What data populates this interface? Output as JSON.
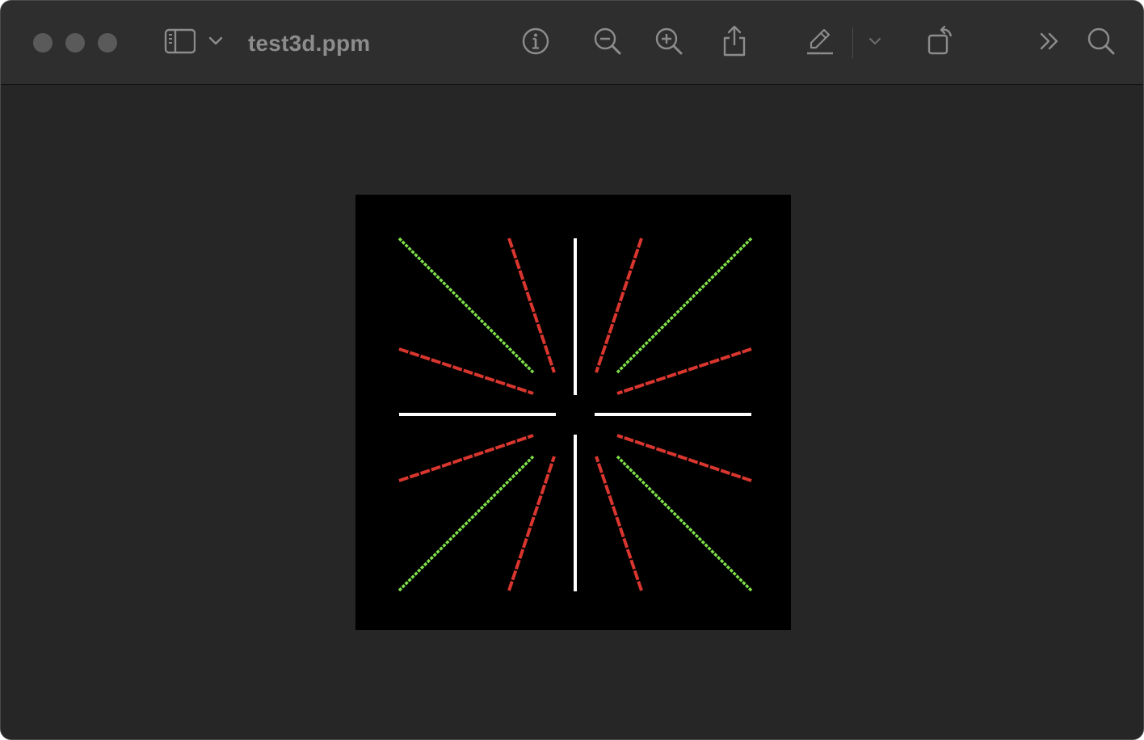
{
  "window": {
    "title": "test3d.ppm"
  },
  "toolbar": {
    "icons": [
      "sidebar-icon",
      "chevron-down-icon",
      "info-icon",
      "zoom-out-icon",
      "zoom-in-icon",
      "share-icon",
      "markup-pen-icon",
      "chevron-down-icon",
      "rotate-icon",
      "more-icon",
      "search-icon"
    ]
  },
  "colors": {
    "window_bg": "#262626",
    "toolbar_bg": "#2e2e2e",
    "icon": "#8c8c8c",
    "image_bg": "#000000",
    "axis_lines": "#ffffff",
    "diagonal_lines": "#7fe04a",
    "steep_shallow_lines": "#d8362e"
  }
}
